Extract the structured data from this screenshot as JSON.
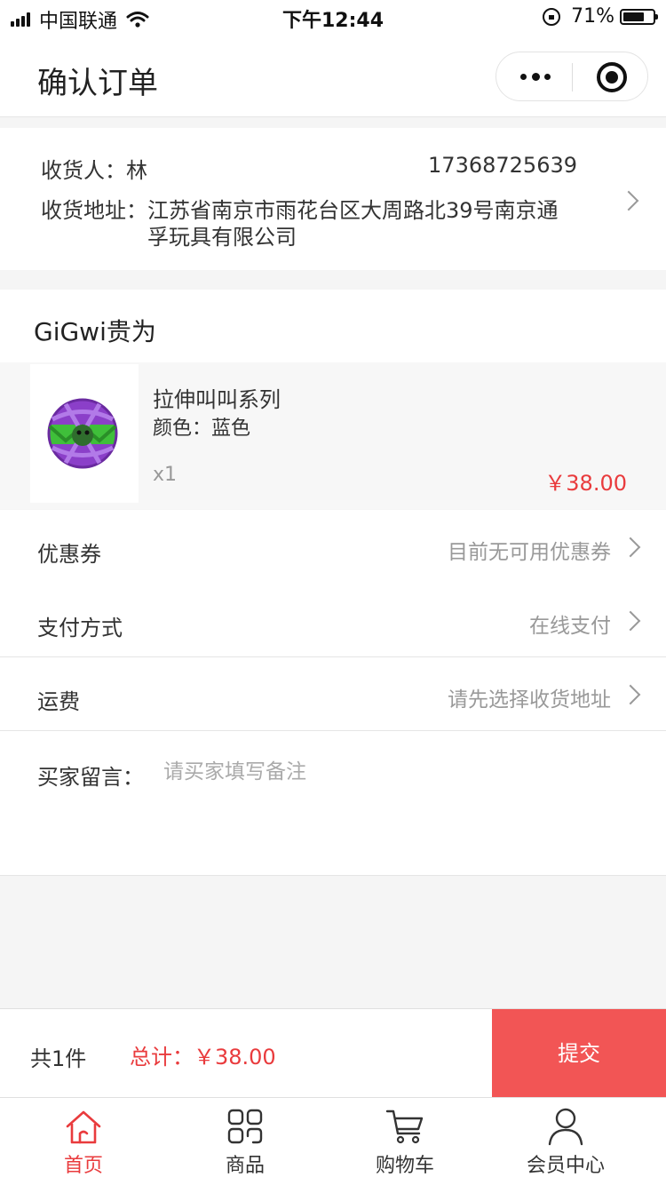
{
  "status_bar": {
    "carrier": "中国联通",
    "time": "下午12:44",
    "battery": "71%"
  },
  "nav": {
    "title": "确认订单"
  },
  "address": {
    "receiver": "收货人：林",
    "phone": "17368725639",
    "address_label": "收货地址：",
    "address_text": "江苏省南京市雨花台区大周路北39号南京通孚玩具有限公司"
  },
  "shop": {
    "name": "GiGwi贵为"
  },
  "product": {
    "name": "拉伸叫叫系列",
    "attr": "颜色：蓝色",
    "qty": "x1",
    "price": "￥38.00"
  },
  "options": {
    "coupon_label": "优惠券",
    "coupon_value": "目前无可用优惠券",
    "payment_label": "支付方式",
    "payment_value": "在线支付",
    "shipping_label": "运费",
    "shipping_value": "请先选择收货地址"
  },
  "message": {
    "label": "买家留言：",
    "placeholder": "请买家填写备注"
  },
  "submit_bar": {
    "count": "共1件",
    "total": "总计：￥38.00",
    "submit_label": "提交"
  },
  "tabs": [
    {
      "label": "首页",
      "icon": "home-icon"
    },
    {
      "label": "商品",
      "icon": "grid-icon"
    },
    {
      "label": "购物车",
      "icon": "cart-icon"
    },
    {
      "label": "会员中心",
      "icon": "user-icon"
    }
  ],
  "colors": {
    "accent": "#e93b3d",
    "submit": "#f25555"
  }
}
